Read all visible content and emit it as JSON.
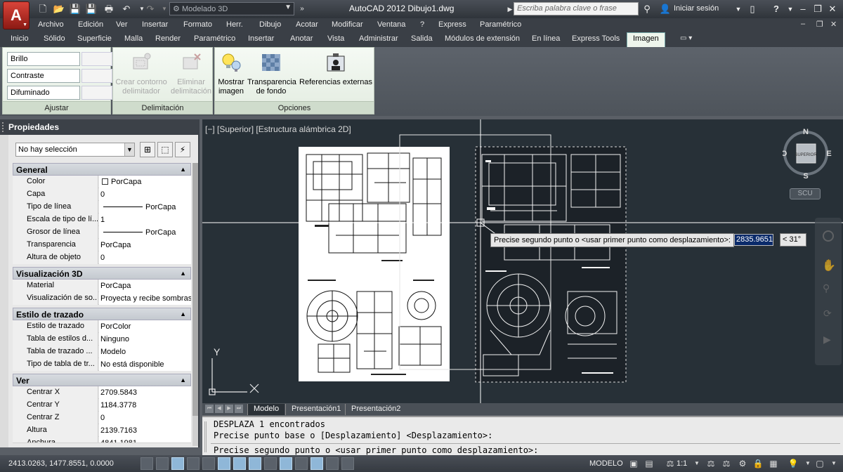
{
  "window": {
    "app_logo": "A",
    "title": "AutoCAD 2012    Dibujo1.dwg",
    "workspace": "Modelado 3D",
    "search_placeholder": "Escriba palabra clave o frase",
    "signin": "Iniciar sesión",
    "help": "?"
  },
  "menu": [
    "Archivo",
    "Edición",
    "Ver",
    "Insertar",
    "Formato",
    "Herr.",
    "Dibujo",
    "Acotar",
    "Modificar",
    "Ventana",
    "?",
    "Express",
    "Paramétrico"
  ],
  "ribbon_tabs": [
    "Inicio",
    "Sólido",
    "Superficie",
    "Malla",
    "Render",
    "Paramétrico",
    "Insertar",
    "Anotar",
    "Vista",
    "Administrar",
    "Salida",
    "Módulos de extensión",
    "En línea",
    "Express Tools",
    "Imagen"
  ],
  "ribbon_active_tab": "Imagen",
  "ribbon": {
    "adjust": {
      "label": "Ajustar",
      "sliders": [
        "Brillo",
        "Contraste",
        "Difuminado"
      ]
    },
    "clip": {
      "label": "Delimitación",
      "create": "Crear contorno delimitador",
      "create_l1": "Crear contorno",
      "create_l2": "delimitador",
      "remove_l1": "Eliminar",
      "remove_l2": "delimitación"
    },
    "options": {
      "label": "Opciones",
      "show_l1": "Mostrar",
      "show_l2": "imagen",
      "transp_l1": "Transparencia",
      "transp_l2": "de fondo",
      "xref": "Referencias externas"
    }
  },
  "properties": {
    "title": "Propiedades",
    "selection": "No hay selección",
    "sections": {
      "general": {
        "title": "General",
        "rows": [
          {
            "k": "Color",
            "v": "PorCapa"
          },
          {
            "k": "Capa",
            "v": "0"
          },
          {
            "k": "Tipo de línea",
            "v": "PorCapa"
          },
          {
            "k": "Escala de tipo de lí...",
            "v": "1"
          },
          {
            "k": "Grosor de línea",
            "v": "PorCapa"
          },
          {
            "k": "Transparencia",
            "v": "PorCapa"
          },
          {
            "k": "Altura de objeto",
            "v": "0"
          }
        ]
      },
      "vis3d": {
        "title": "Visualización 3D",
        "rows": [
          {
            "k": "Material",
            "v": "PorCapa"
          },
          {
            "k": "Visualización de so...",
            "v": "Proyecta y recibe sombras"
          }
        ]
      },
      "plot": {
        "title": "Estilo de trazado",
        "rows": [
          {
            "k": "Estilo de trazado",
            "v": "PorColor"
          },
          {
            "k": "Tabla de estilos d...",
            "v": "Ninguno"
          },
          {
            "k": "Tabla de trazado ...",
            "v": "Modelo"
          },
          {
            "k": "Tipo de tabla de tr...",
            "v": "No está disponible"
          }
        ]
      },
      "view": {
        "title": "Ver",
        "rows": [
          {
            "k": "Centrar X",
            "v": "2709.5843"
          },
          {
            "k": "Centrar Y",
            "v": "1184.3778"
          },
          {
            "k": "Centrar Z",
            "v": "0"
          },
          {
            "k": "Altura",
            "v": "2139.7163"
          },
          {
            "k": "Anchura",
            "v": "4841.1981"
          }
        ]
      }
    }
  },
  "viewport": {
    "label": "[−] [Superior] [Estructura alámbrica 2D]",
    "compass": {
      "n": "N",
      "s": "S",
      "e": "E",
      "o": "O",
      "face": "SUPERIOR"
    },
    "ucs": "SCU",
    "axis_x": "X",
    "axis_y": "Y"
  },
  "dynamic_input": {
    "prompt": "Precise segundo punto o <usar primer punto como desplazamiento>:",
    "value": "2835.9651",
    "angle": "< 31°"
  },
  "layout_tabs": [
    "Modelo",
    "Presentación1",
    "Presentación2"
  ],
  "command_lines": [
    "DESPLAZA 1 encontrados",
    "Precise punto base o [Desplazamiento] <Desplazamiento>:",
    "Precise segundo punto o <usar primer punto como desplazamiento>:"
  ],
  "status": {
    "coords": "2413.0263, 1477.8551, 0.0000",
    "space": "MODELO",
    "scale": "1:1"
  }
}
